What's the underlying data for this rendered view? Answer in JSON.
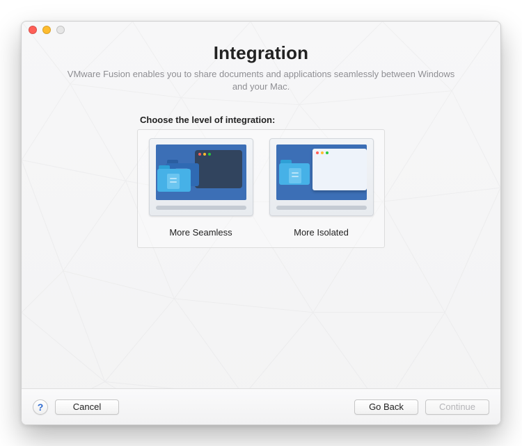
{
  "header": {
    "title": "Integration",
    "subtitle": "VMware Fusion enables you to share documents and applications seamlessly between Windows and your Mac."
  },
  "section": {
    "prompt": "Choose the level of integration:"
  },
  "choices": {
    "seamless": {
      "label": "More Seamless"
    },
    "isolated": {
      "label": "More Isolated"
    }
  },
  "footer": {
    "help_symbol": "?",
    "cancel": "Cancel",
    "go_back": "Go Back",
    "continue": "Continue",
    "continue_enabled": false
  },
  "window_controls": {
    "close": "close",
    "minimize": "minimize",
    "zoom": "zoom"
  }
}
